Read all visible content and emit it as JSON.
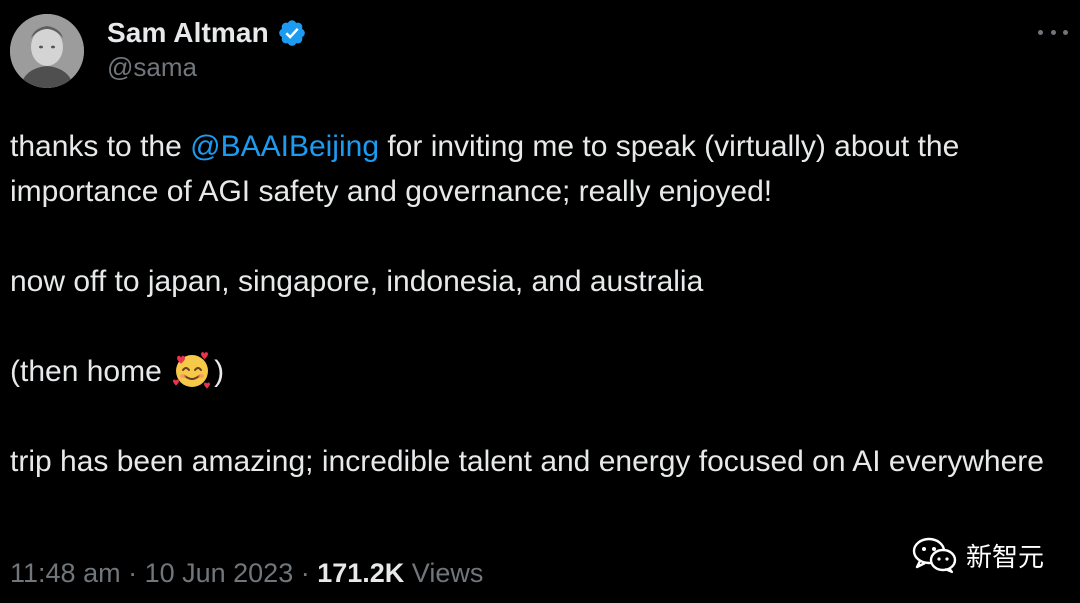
{
  "author": {
    "name": "Sam Altman",
    "handle": "@sama",
    "verified": true
  },
  "tweet": {
    "paragraph1": {
      "before": "thanks to the ",
      "mention": "@BAAIBeijing",
      "after": " for inviting me to speak (virtually) about the importance of AGI safety and governance; really enjoyed!"
    },
    "paragraph2": "now off to japan, singapore, indonesia, and australia",
    "paragraph3": {
      "before": "(then home ",
      "emoji": "smiling-face-with-hearts",
      "after": ")"
    },
    "paragraph4": "trip has been amazing; incredible talent and energy focused on AI everywhere"
  },
  "meta": {
    "time": "11:48 am",
    "separator1": " · ",
    "date": "10 Jun 2023",
    "separator2": " · ",
    "views_count": "171.2K",
    "views_label": " Views"
  },
  "watermark": {
    "text": "新智元"
  },
  "colors": {
    "background": "#000000",
    "text": "#e7e9ea",
    "muted": "#71767b",
    "link": "#1d9bf0",
    "verified": "#1d9bf0"
  },
  "icons": {
    "verified": "verified-badge-icon",
    "more": "more-options-icon",
    "watermark": "wechat-logo-icon"
  }
}
